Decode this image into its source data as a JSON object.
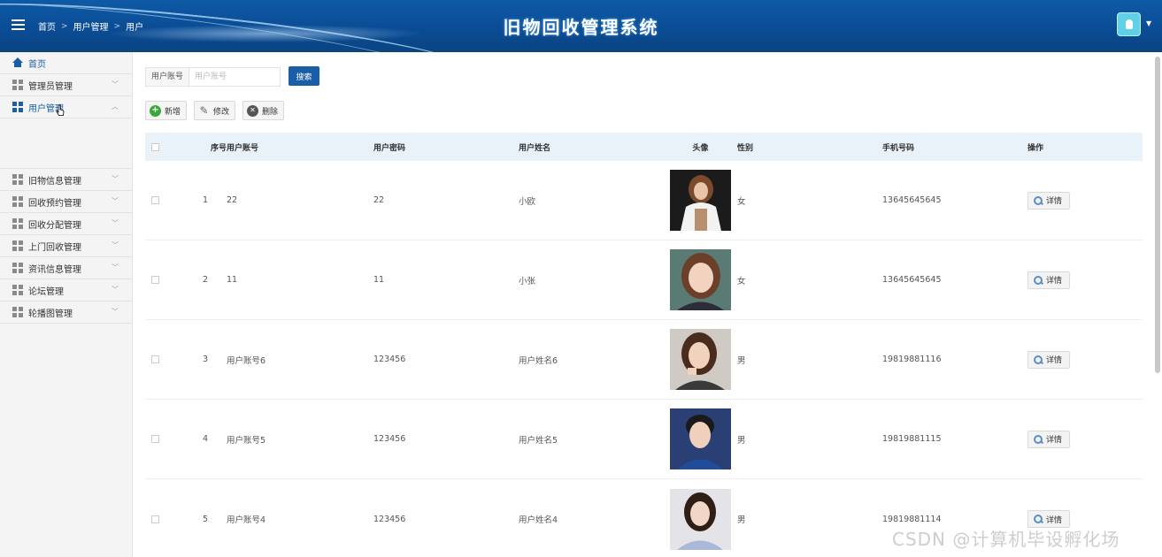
{
  "header": {
    "title": "旧物回收管理系统",
    "breadcrumb": [
      "首页",
      "用户管理",
      "用户"
    ]
  },
  "sidebar": {
    "items": [
      {
        "label": "首页",
        "icon": "home-icon"
      },
      {
        "label": "管理员管理",
        "icon": "grid-icon"
      },
      {
        "label": "用户管理",
        "icon": "grid-icon",
        "active": true
      },
      {
        "label": "旧物信息管理",
        "icon": "grid-icon"
      },
      {
        "label": "回收预约管理",
        "icon": "grid-icon"
      },
      {
        "label": "回收分配管理",
        "icon": "grid-icon"
      },
      {
        "label": "上门回收管理",
        "icon": "grid-icon"
      },
      {
        "label": "资讯信息管理",
        "icon": "grid-icon"
      },
      {
        "label": "论坛管理",
        "icon": "grid-icon"
      },
      {
        "label": "轮播图管理",
        "icon": "grid-icon"
      }
    ]
  },
  "search": {
    "label": "用户账号",
    "placeholder": "用户账号",
    "button": "搜索"
  },
  "toolbar": {
    "add": "新增",
    "edit": "修改",
    "delete": "删除"
  },
  "table": {
    "headers": {
      "no": "序号",
      "account": "用户账号",
      "password": "用户密码",
      "name": "用户姓名",
      "avatar": "头像",
      "gender": "性别",
      "phone": "手机号码",
      "actions": "操作"
    },
    "detail_label": "详情",
    "rows": [
      {
        "no": "1",
        "account": "22",
        "password": "22",
        "name": "小欧",
        "gender": "女",
        "phone": "13645645645"
      },
      {
        "no": "2",
        "account": "11",
        "password": "11",
        "name": "小张",
        "gender": "女",
        "phone": "13645645645"
      },
      {
        "no": "3",
        "account": "用户账号6",
        "password": "123456",
        "name": "用户姓名6",
        "gender": "男",
        "phone": "19819881116"
      },
      {
        "no": "4",
        "account": "用户账号5",
        "password": "123456",
        "name": "用户姓名5",
        "gender": "男",
        "phone": "19819881115"
      },
      {
        "no": "5",
        "account": "用户账号4",
        "password": "123456",
        "name": "用户姓名4",
        "gender": "男",
        "phone": "19819881114"
      }
    ]
  },
  "watermark": "CSDN @计算机毕设孵化场"
}
